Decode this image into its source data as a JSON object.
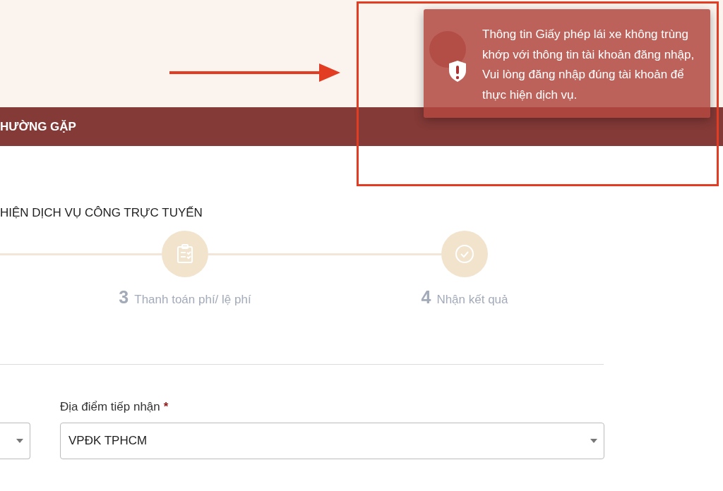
{
  "nav": {
    "items": [
      {
        "label": "HƯỜNG GẶP"
      }
    ]
  },
  "section_title": "HIỆN DỊCH VỤ CÔNG TRỰC TUYẾN",
  "steps": [
    {
      "number": "3",
      "label": "Thanh toán phí/ lệ phí",
      "kind": "clipboard"
    },
    {
      "number": "4",
      "label": "Nhận kết quả",
      "kind": "check"
    }
  ],
  "field": {
    "label": "Địa điểm tiếp nhận",
    "required": true,
    "required_mark": "*",
    "value": "VPĐK TPHCM"
  },
  "toast": {
    "message": "Thông tin Giấy phép lái xe không trùng khớp với thông tin tài khoản đăng nhập, Vui lòng đăng nhập đúng tài khoản để thực hiện dịch vụ."
  }
}
